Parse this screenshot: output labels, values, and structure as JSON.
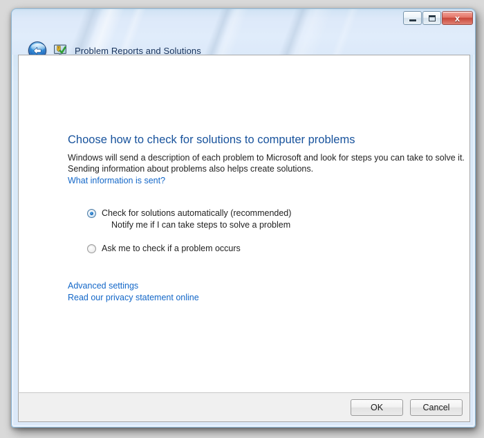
{
  "window": {
    "title": "Problem Reports and Solutions",
    "app_icon": "problem-reports-monitor-icon",
    "back_icon": "back-arrow-icon",
    "caption": {
      "minimize_label": "–",
      "minimize_icon": "minimize-icon",
      "maximize_icon": "maximize-icon",
      "close_label": "x",
      "close_icon": "close-icon",
      "close_color": "#c9483b"
    },
    "frame_color": "#dce9f9",
    "titlebar_text_color": "#17325a"
  },
  "page": {
    "heading": "Choose how to check for solutions to computer problems",
    "heading_color": "#17529c",
    "body_line1": "Windows will send a description of each problem to Microsoft and look for steps you can take to solve it.",
    "body_line2": "Sending information about problems also helps create solutions.",
    "what_info_link": "What information is sent?",
    "link_color": "#1367c8"
  },
  "options": [
    {
      "label": "Check for solutions automatically (recommended)",
      "sublabel": "Notify me if I can take steps to solve a problem",
      "selected": true
    },
    {
      "label": "Ask me to check if a problem occurs",
      "sublabel": "",
      "selected": false
    }
  ],
  "links": [
    {
      "label": "Advanced settings"
    },
    {
      "label": "Read our privacy statement online"
    }
  ],
  "footer": {
    "ok_label": "OK",
    "cancel_label": "Cancel"
  }
}
